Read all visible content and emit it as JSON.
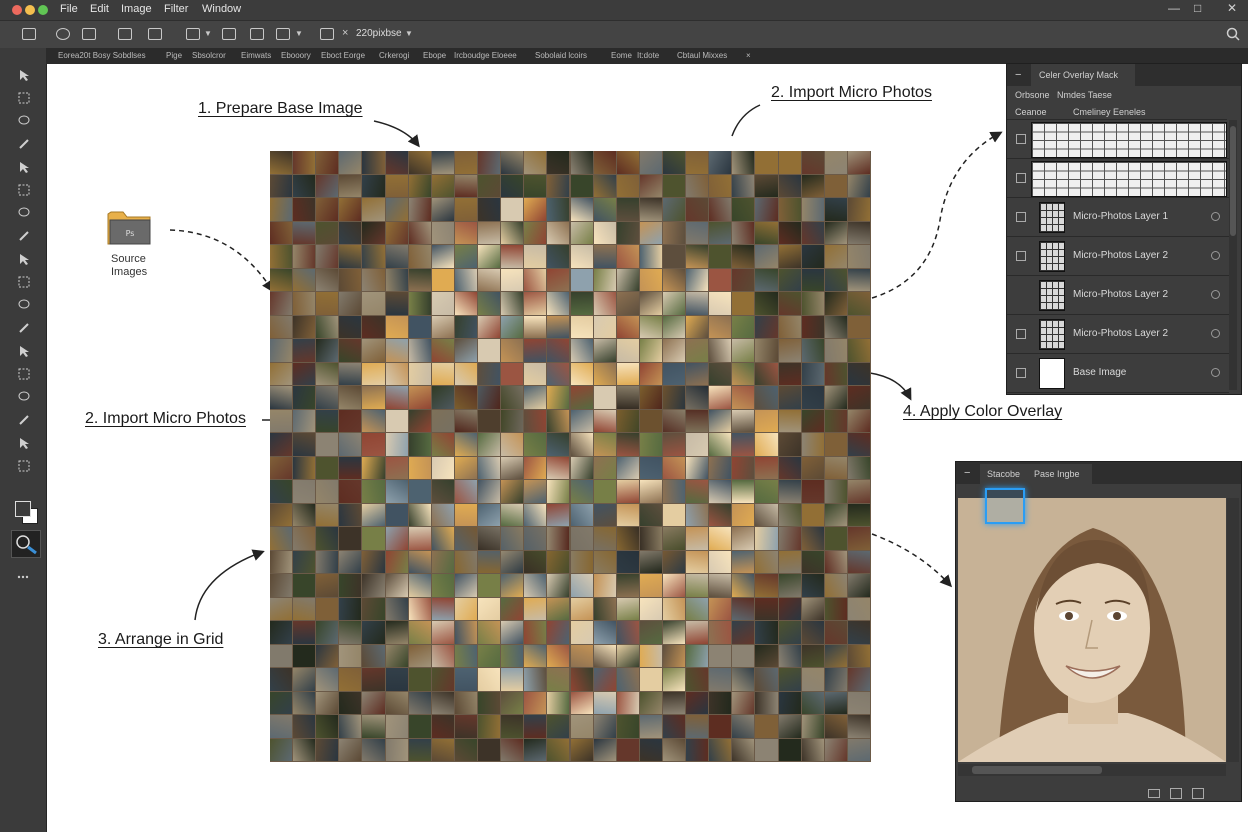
{
  "menubar": {
    "traffic_colors": [
      "#ed6a5e",
      "#f5bf4f",
      "#61c554"
    ],
    "items": [
      "File",
      "Edit",
      "Image",
      "Filter",
      "Window"
    ],
    "window_controls": {
      "minimize": "—",
      "maximize": "□",
      "close": "✕"
    }
  },
  "optionsbar": {
    "zoom_label": "220pixbse",
    "close_glyph": "×",
    "search_icon": "search-icon"
  },
  "tabs": [
    "Eorea20t Bosy Sobdlses",
    "Pige",
    "Sbsolcror",
    "Eimwats",
    "Ebooory",
    "Eboct Eorge",
    "Crkerogi",
    "Ebope",
    "Ircboudge Eloeee",
    "Sobolaid lcoirs",
    "Eome",
    "It:dote",
    "Cbtaul Mixxes"
  ],
  "callouts": {
    "prepare": "1. Prepare Base Image",
    "import_top": "2. Import Micro Photos",
    "import_left": "2. Import Micro Photos",
    "arrange": "3. Arrange in Grid",
    "overlay": "4. Apply Color Overlay"
  },
  "source": {
    "folder_line1": "Source",
    "folder_line2": "Images",
    "folder_color": "#e8b04a"
  },
  "layers_panel": {
    "title": "Celer Overlay Mack",
    "subtabs": [
      "Orbsone",
      "Nmdes Taese"
    ],
    "subheader": [
      "Ceanoe",
      "Cmeliney Eeneles"
    ],
    "layers": [
      {
        "name": "",
        "thumb": "grid"
      },
      {
        "name": "",
        "thumb": "grid"
      },
      {
        "name": "Micro-Photos Layer 1",
        "thumb": "mini"
      },
      {
        "name": "Micro-Photos Layer 2",
        "thumb": "mini"
      },
      {
        "name": "Micro-Photos Layer 2",
        "thumb": "mini"
      },
      {
        "name": "Micro-Photos Layer 2",
        "thumb": "mini"
      },
      {
        "name": "Base Image",
        "thumb": "white"
      }
    ]
  },
  "preview_panel": {
    "tabs": [
      "Stacobe",
      "Pase Ingbe"
    ],
    "sepia_color": "#c4ae92",
    "selection_color": "#2a9df4"
  }
}
